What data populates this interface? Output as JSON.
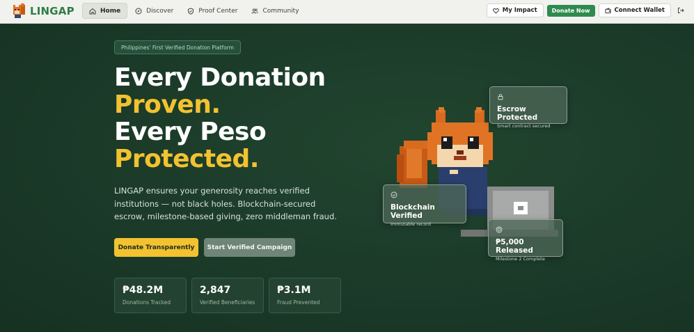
{
  "app": {
    "name": "LINGAP"
  },
  "nav": {
    "links": [
      {
        "label": "Home",
        "icon": "home-icon",
        "active": true
      },
      {
        "label": "Discover",
        "icon": "compass-icon",
        "active": false
      },
      {
        "label": "Proof Center",
        "icon": "shield-icon",
        "active": false
      },
      {
        "label": "Community",
        "icon": "users-icon",
        "active": false
      }
    ],
    "my_impact": "My Impact",
    "donate_now": "Donate Now",
    "connect_wallet": "Connect Wallet"
  },
  "hero": {
    "badge": "Philippines' First Verified Donation Platform",
    "headline": [
      "Every Donation",
      "Proven.",
      "Every Peso",
      "Protected."
    ],
    "subtitle": "LINGAP ensures your generosity reaches verified institutions — not black holes. Blockchain-secured escrow, milestone-based giving, zero middleman fraud.",
    "primary_button": "Donate Transparently",
    "secondary_button": "Start Verified Campaign"
  },
  "stats": [
    {
      "value": "₱48.2M",
      "label": "Donations Tracked"
    },
    {
      "value": "2,847",
      "label": "Verified Beneficiaries"
    },
    {
      "value": "₱3.1M",
      "label": "Fraud Prevented"
    }
  ],
  "cards": {
    "escrow": {
      "title": "Escrow Protected",
      "subtitle": "Smart contract secured"
    },
    "blockchain": {
      "title": "Blockchain Verified",
      "subtitle": "Immutable record"
    },
    "released": {
      "title": "₱5,000 Released",
      "subtitle": "Milestone 2 Complete"
    }
  },
  "colors": {
    "accent": "#f2c230",
    "brand": "#2f8a4e",
    "background": "#1b3a29"
  }
}
